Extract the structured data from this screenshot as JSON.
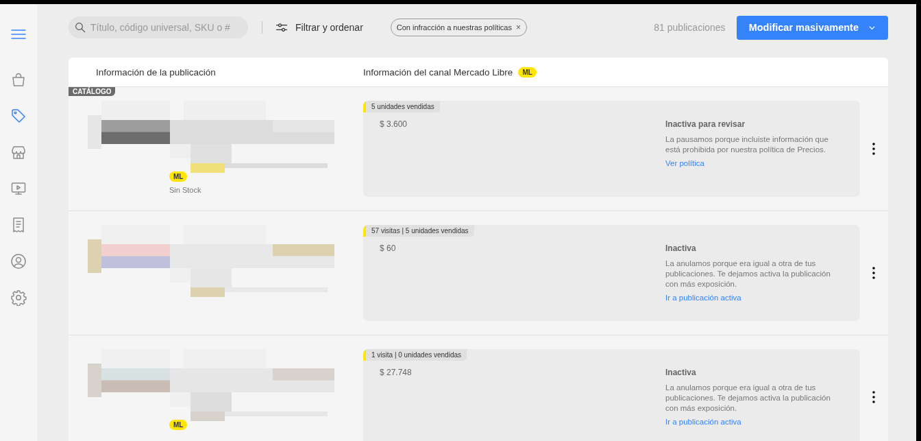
{
  "sidebar": {
    "items": [
      {
        "kind": "menu"
      },
      {
        "kind": "bag",
        "selected": false
      },
      {
        "kind": "tag",
        "selected": true
      },
      {
        "kind": "store",
        "selected": false
      },
      {
        "kind": "video",
        "selected": false
      },
      {
        "kind": "receipt",
        "selected": false
      },
      {
        "kind": "user",
        "selected": false
      },
      {
        "kind": "gear",
        "selected": false
      }
    ]
  },
  "toolbar": {
    "search": {
      "placeholder": "Título, código universal, SKU o #"
    },
    "filter_button": "Filtrar y ordenar",
    "filter_chip": "Con infracción a nuestras políticas",
    "chip_close": "×",
    "count": "81 publicaciones",
    "bulk_button": "Modificar masivamente"
  },
  "table": {
    "columns": [
      "Información de la publicación",
      "Información del canal Mercado Libre"
    ],
    "column_badge": "ML",
    "rows": [
      {
        "catalog_badge": "CATÁLOGO",
        "channel_badge": "ML",
        "stock": "Sin Stock",
        "stats": "5 unidades vendidas",
        "price": "$ 3.600",
        "status": "Inactiva para revisar",
        "message": "La pausamos porque incluiste información que está prohibida por nuestra política de Precios.",
        "link": "Ver política"
      },
      {
        "stats": "57 visitas | 5 unidades vendidas",
        "price": "$ 60",
        "status": "Inactiva",
        "message": "La anulamos porque era igual a otra de tus publicaciones. Te dejamos activa la publicación con más exposición.",
        "link": "Ir a publicación activa"
      },
      {
        "channel_badge": "ML",
        "stats": "1 visita | 0 unidades vendidas",
        "price": "$ 27.748",
        "status": "Inactiva",
        "message": "La anulamos porque era igual a otra de tus publicaciones. Te dejamos activa la publicación con más exposición.",
        "link": "Ir a publicación activa"
      }
    ]
  }
}
